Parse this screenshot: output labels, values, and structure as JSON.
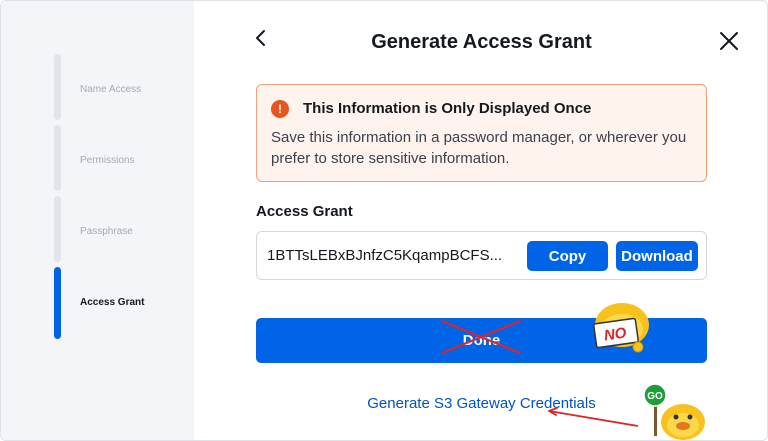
{
  "sidebar": {
    "steps": [
      {
        "label": "Name Access",
        "active": false
      },
      {
        "label": "Permissions",
        "active": false
      },
      {
        "label": "Passphrase",
        "active": false
      },
      {
        "label": "Access Grant",
        "active": true
      }
    ]
  },
  "dialog": {
    "title": "Generate Access Grant",
    "back_icon": "chevron-left-icon",
    "close_icon": "close-icon"
  },
  "warning": {
    "icon": "exclamation-icon",
    "title": "This Information is Only Displayed Once",
    "body": "Save this information in a password manager, or wherever you prefer to store sensitive information."
  },
  "access_grant": {
    "label": "Access Grant",
    "value": "1BTTsLEBxBJnfzC5KqampBCFS...",
    "copy_label": "Copy",
    "download_label": "Download"
  },
  "done_label": "Done",
  "gateway_link": "Generate S3 Gateway Credentials",
  "stickers": {
    "no_text": "NO",
    "go_text": "GO"
  },
  "colors": {
    "primary": "#0064e6",
    "warning_bg": "#fff3ee",
    "warning_border": "#f2a077",
    "warning_icon": "#e9541f",
    "annotation_red": "#d9262c"
  }
}
